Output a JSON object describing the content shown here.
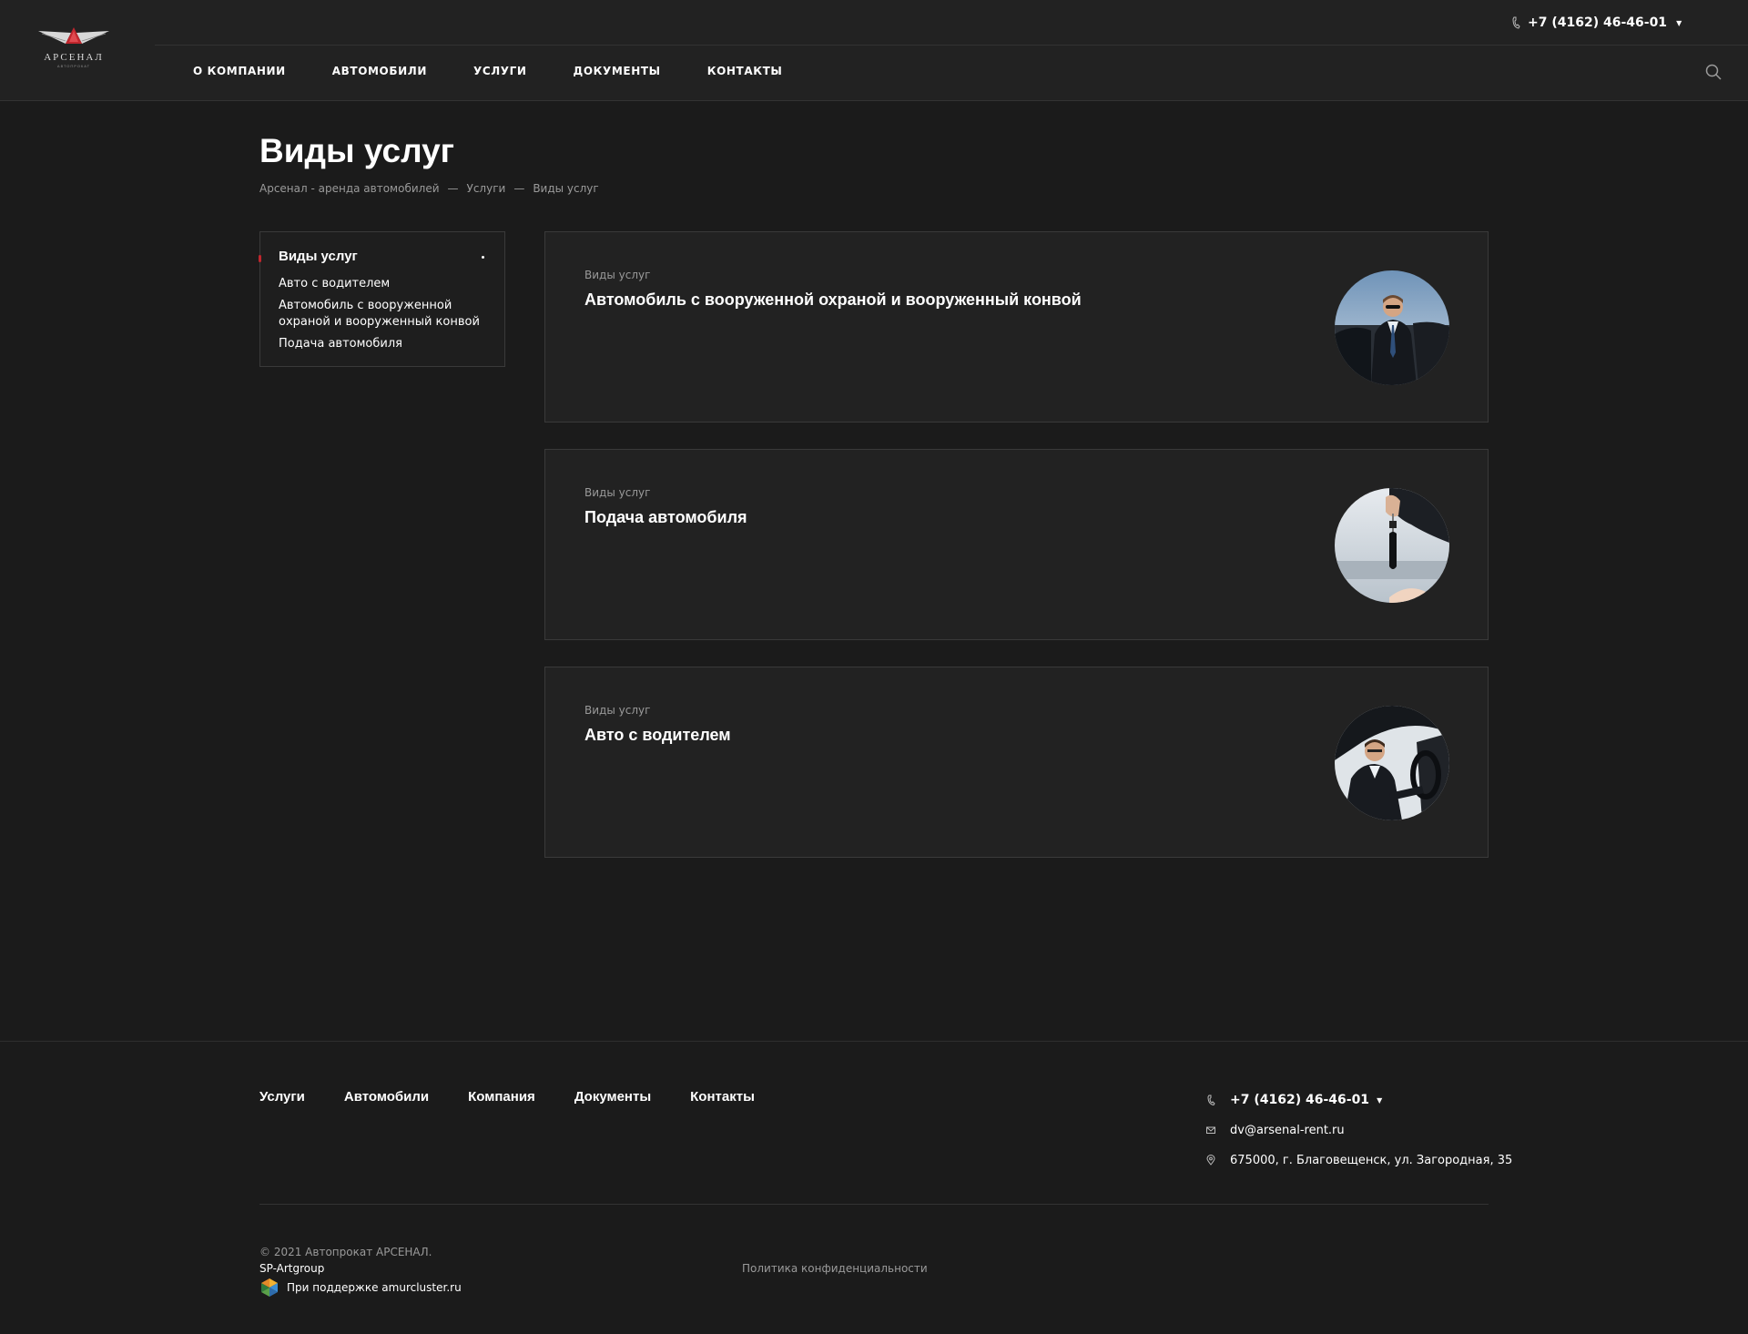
{
  "header": {
    "logo_text": "АРСЕНАЛ",
    "logo_sub": "АВТОПРОКАТ",
    "phone": "+7 (4162) 46-46-01",
    "nav": [
      {
        "label": "О КОМПАНИИ"
      },
      {
        "label": "АВТОМОБИЛИ"
      },
      {
        "label": "УСЛУГИ"
      },
      {
        "label": "ДОКУМЕНТЫ"
      },
      {
        "label": "КОНТАКТЫ"
      }
    ]
  },
  "page": {
    "title": "Виды услуг",
    "breadcrumb": [
      {
        "label": "Арсенал - аренда автомобилей"
      },
      {
        "label": "Услуги"
      },
      {
        "label": "Виды услуг"
      }
    ],
    "breadcrumb_sep": "—"
  },
  "sidebar": {
    "title": "Виды услуг",
    "items": [
      {
        "label": "Авто с водителем"
      },
      {
        "label": "Автомобиль с вооруженной охраной и вооруженный конвой"
      },
      {
        "label": "Подача автомобиля"
      }
    ]
  },
  "cards": [
    {
      "category": "Виды услуг",
      "title": "Автомобиль с вооруженной охраной и вооруженный конвой",
      "image": "bodyguard-photo"
    },
    {
      "category": "Виды услуг",
      "title": "Подача автомобиля",
      "image": "car-keys-photo"
    },
    {
      "category": "Виды услуг",
      "title": "Авто с водителем",
      "image": "chauffeur-photo"
    }
  ],
  "footer": {
    "nav": [
      {
        "label": "Услуги"
      },
      {
        "label": "Автомобили"
      },
      {
        "label": "Компания"
      },
      {
        "label": "Документы"
      },
      {
        "label": "Контакты"
      }
    ],
    "phone": "+7 (4162) 46-46-01",
    "email": "dv@arsenal-rent.ru",
    "address": "675000, г. Благовещенск, ул. Загородная, 35",
    "copyright": "© 2021 Автопрокат АРСЕНАЛ.",
    "developer": "SP-Artgroup",
    "support": "При поддержке amurcluster.ru",
    "privacy": "Политика конфиденциальности"
  },
  "colors": {
    "background": "#1b1b1b",
    "header": "#222222",
    "card": "#222222",
    "accent": "#c0262d",
    "muted_text": "#9a9a9a"
  }
}
